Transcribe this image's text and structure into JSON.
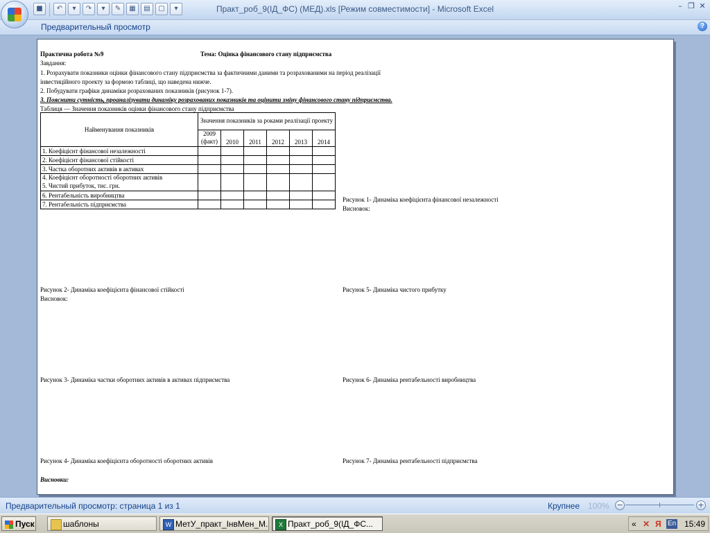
{
  "window": {
    "title": "Практ_роб_9(ІД_ФС) (МЕД).xls  [Режим совместимости] - Microsoft Excel",
    "controls": [
      "minimize-icon",
      "restore-icon",
      "close-icon"
    ]
  },
  "quick_access": [
    "save-icon",
    "undo-icon",
    "redo-icon",
    "print-preview-icon",
    "customize-icon"
  ],
  "ribbon": {
    "tab_label": "Предварительный просмотр",
    "help": "?"
  },
  "sheet": {
    "title_left": "Практична робота №9",
    "title_right": "Тема: Оцінка фінансового стану підприємства",
    "task_heading": "Завдання:",
    "task1_line1": "1. Розрахувати показники оцінки фінансового стану підприємства за фактичними даними та розрахованими на період реалізації",
    "task1_line2": " інвестиційного проекту за формою таблиці, що наведена нижче.",
    "task2": "2. Побудувати графіки динаміки розрахованих показників (рисунок 1-7).",
    "task3": "3. Пояснити сутність, проаналізувати динаміку розрахованих показників та оцінити зміну фінансового стану підприємства.",
    "table_caption": "Таблиця  — Значення показників оцінки фінансового стану підприємства",
    "table": {
      "name_header": "Найменування показників",
      "values_header": "Значення показників за роками реалізації проекту",
      "years": [
        "2009 (факт)",
        "2010",
        "2011",
        "2012",
        "2013",
        "2014"
      ],
      "rows": [
        "1. Коефіцієнт фінансової незалежності",
        "2. Коефіцієнт фінансової стійкості",
        "3. Частка оборотних активів в активах",
        "4. Коефіцієнт оборотності оборотних активів",
        "5. Чистий прибуток, тис. грн.",
        "6. Рентабельність виробництва",
        "7. Рентабельність підприємства"
      ]
    },
    "figures": {
      "fig1": "Рисунок 1- Динаміка коефіцієнта фінансової незалежності",
      "fig1_conclusion": "Висновок:",
      "fig2": "Рисунок 2- Динаміка коефіцієнта фінансової стійкості",
      "fig2_conclusion": "Висновок:",
      "fig3": "Рисунок 3- Динаміка частки оборотних активів в активах підприємства",
      "fig4": "Рисунок 4- Динаміка коефіцієнта оборотності оборотних активів",
      "fig5": "Рисунок 5- Динаміка чистого прибутку",
      "fig6": "Рисунок 6- Динаміка рентабельності виробництва",
      "fig7": "Рисунок 7- Динаміка рентабельності підприємства"
    },
    "final_conclusions": "Висновки:"
  },
  "status": {
    "text": "Предварительный просмотр: страница 1 из 1",
    "zoom_label": "Крупнее",
    "zoom_value": "100%"
  },
  "taskbar": {
    "start": "Пуск",
    "buttons": [
      {
        "label": "шаблоны",
        "icon": "folder-icon"
      },
      {
        "label": "МетУ_практ_ІнвМен_М...",
        "icon": "word-doc-icon"
      },
      {
        "label": "Практ_роб_9(ІД_ФС...",
        "icon": "excel-doc-icon"
      }
    ],
    "tray": {
      "arrows": "«",
      "lang": "En",
      "time": "15:49"
    }
  },
  "colors": {
    "ribbon_text": "#15428b",
    "title_text": "#3d5b84",
    "workspace": "#a3b9d7"
  }
}
